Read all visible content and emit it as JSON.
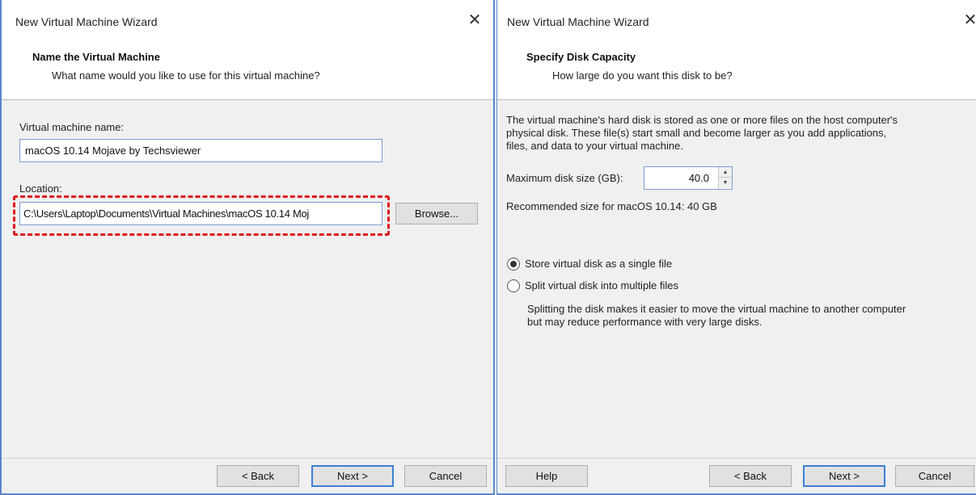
{
  "left_dialog": {
    "title": "New Virtual Machine Wizard",
    "heading": "Name the Virtual Machine",
    "subheading": "What name would you like to use for this virtual machine?",
    "vm_name_label": "Virtual machine name:",
    "vm_name_value": "macOS 10.14 Mojave by Techsviewer",
    "location_label": "Location:",
    "location_value": "C:\\Users\\Laptop\\Documents\\Virtual Machines\\macOS 10.14 Moj",
    "browse_label": "Browse...",
    "back_label": "< Back",
    "next_label": "Next >",
    "cancel_label": "Cancel"
  },
  "right_dialog": {
    "title": "New Virtual Machine Wizard",
    "heading": "Specify Disk Capacity",
    "subheading": "How large do you want this disk to be?",
    "description_line1": "The virtual machine's hard disk is stored as one or more files on the host computer's",
    "description_line2": "physical disk. These file(s) start small and become larger as you add applications,",
    "description_line3": "files, and data to your virtual machine.",
    "max_disk_label": "Maximum disk size (GB):",
    "max_disk_value": "40.0",
    "recommended_text": "Recommended size for macOS 10.14: 40 GB",
    "option_single": "Store virtual disk as a single file",
    "option_split": "Split virtual disk into multiple files",
    "selected_option": "single",
    "split_note_line1": "Splitting the disk makes it easier to move the virtual machine to another computer",
    "split_note_line2": "but may reduce performance with very large disks.",
    "help_label": "Help",
    "back_label": "< Back",
    "next_label": "Next >",
    "cancel_label": "Cancel"
  },
  "colors": {
    "window_border": "#5a86c8",
    "highlight": "#e0141e",
    "default_button_border": "#3c7fd5",
    "dialog_body": "#f0f0f0"
  },
  "icons": {
    "close": "close-icon",
    "spin_up": "spin-up-icon",
    "spin_down": "spin-down-icon"
  }
}
